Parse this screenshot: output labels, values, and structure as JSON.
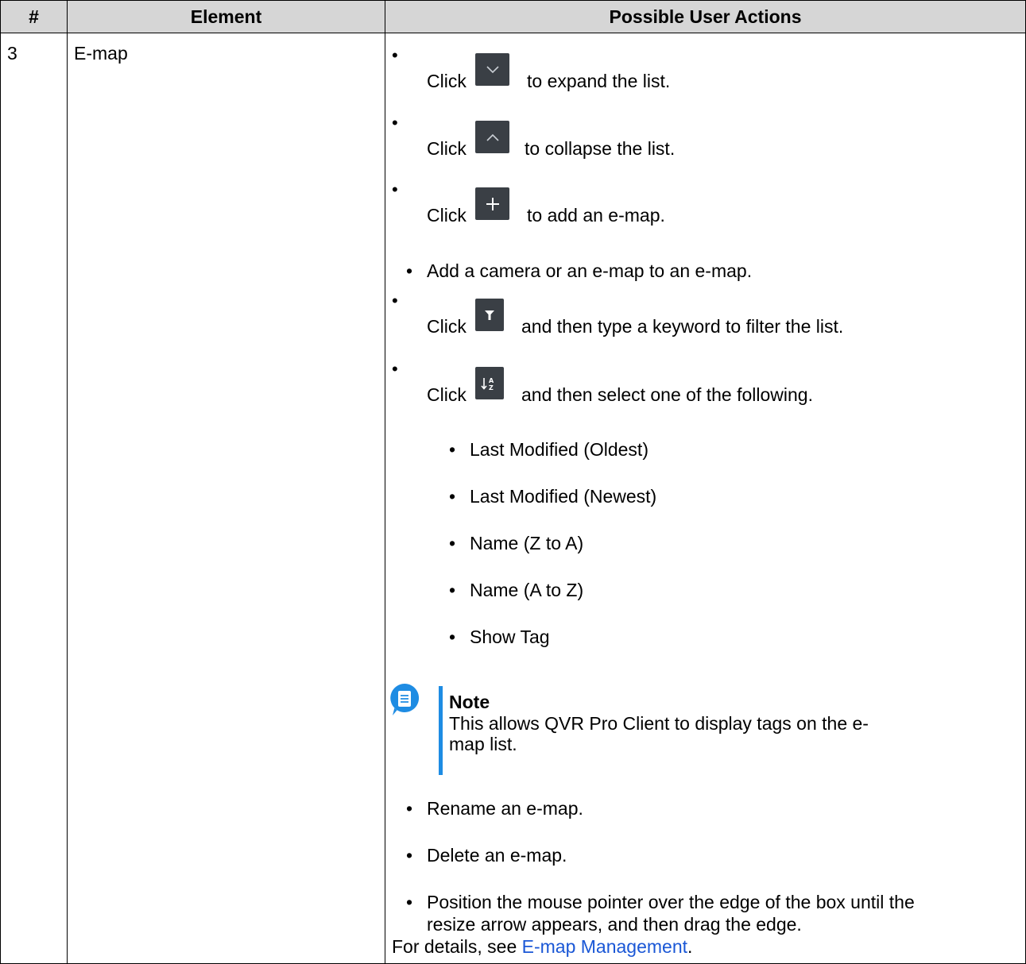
{
  "table": {
    "headers": [
      "#",
      "Element",
      "Possible User Actions"
    ],
    "row": {
      "number": "3",
      "element": "E-map",
      "actions": {
        "bullet": "•",
        "click_word": "Click",
        "expand": {
          "icon": "chevron-down-icon",
          "text": "to expand the list."
        },
        "collapse": {
          "icon": "chevron-up-icon",
          "text": "to collapse the list."
        },
        "add": {
          "icon": "plus-icon",
          "text": "to add an e-map."
        },
        "add_camera": "Add a camera or an e-map to an e-map.",
        "filter": {
          "icon": "filter-icon",
          "text": "and then type a keyword to filter the list."
        },
        "sort": {
          "icon": "sort-az-icon",
          "text": "and then select one of the following."
        },
        "sort_options": [
          "Last Modified (Oldest)",
          "Last Modified (Newest)",
          "Name (Z to A)",
          "Name (A to Z)",
          "Show Tag"
        ],
        "note": {
          "icon": "note-icon",
          "title": "Note",
          "text": "This allows QVR Pro Client to display tags on the e-map list."
        },
        "rename": "Rename an e-map.",
        "delete": "Delete an e-map.",
        "resize": [
          "Position the mouse pointer over the edge of the box until the",
          "resize arrow appears, and then drag the edge."
        ],
        "details_prefix": "For details, see ",
        "details_link": "E-map Management",
        "details_suffix": "."
      }
    }
  },
  "colors": {
    "header_bg": "#d6d6d6",
    "icon_bg": "#3a3f45",
    "note_accent": "#1e8ce3",
    "link": "#1a57d6"
  }
}
